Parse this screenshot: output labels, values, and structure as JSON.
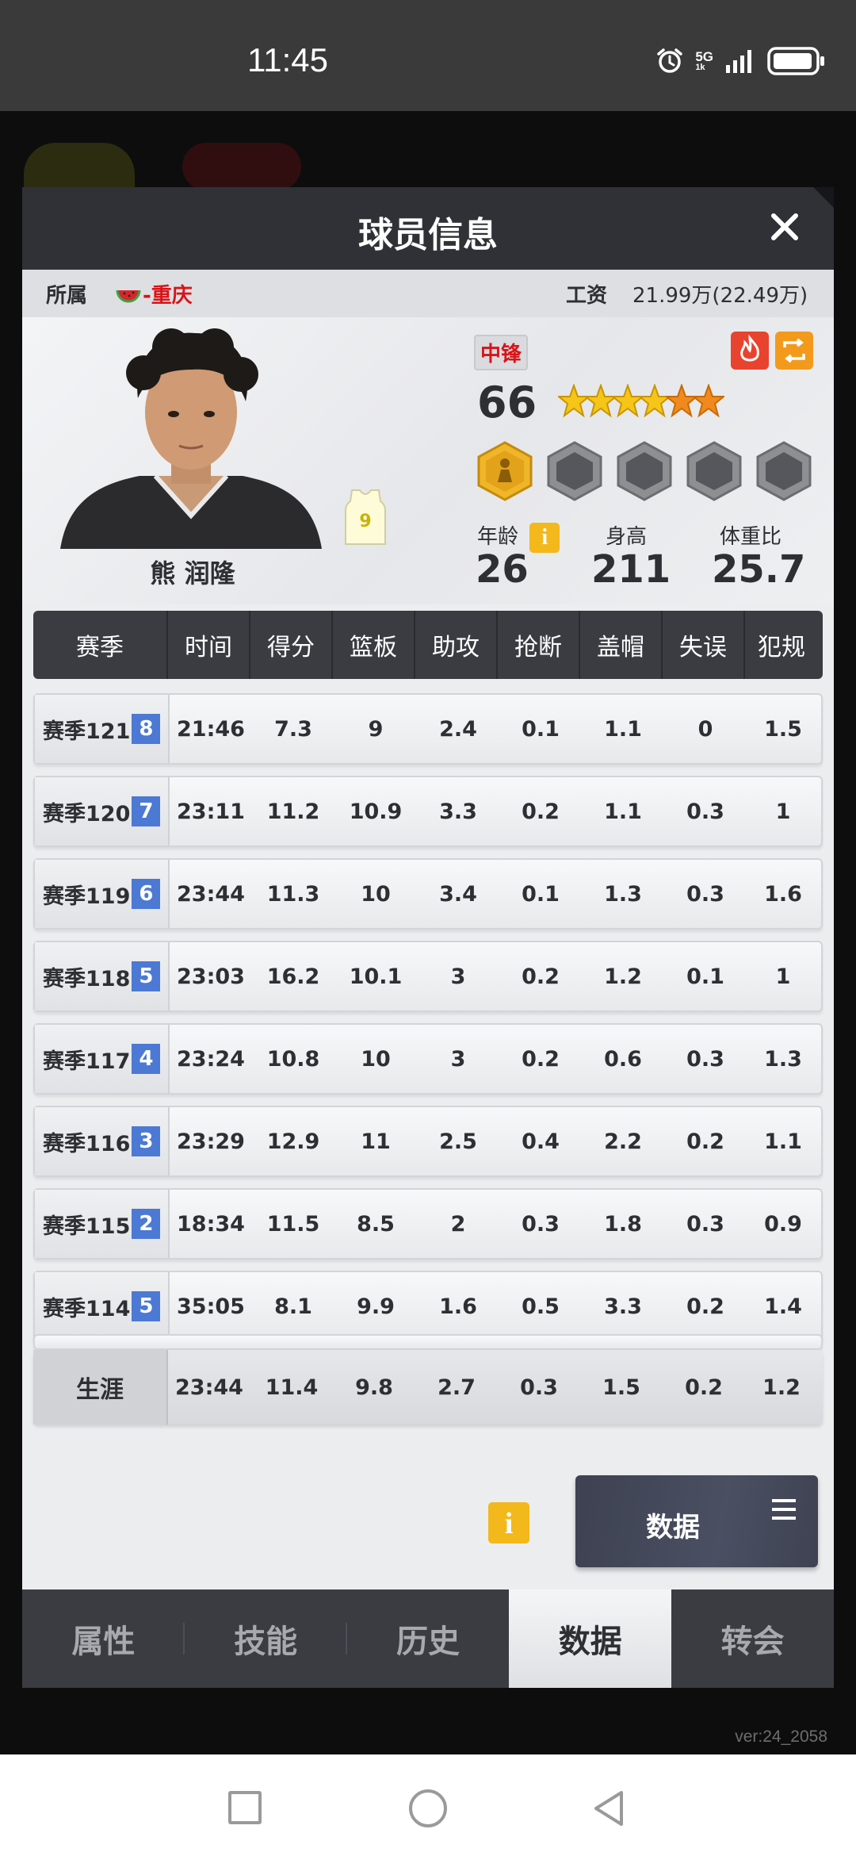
{
  "status_bar": {
    "time": "11:45",
    "network": "5G",
    "network_sub": "1k"
  },
  "modal": {
    "title": "球员信息"
  },
  "team_row": {
    "label": "所属",
    "team": "-重庆",
    "salary_label": "工资",
    "salary": "21.99万(22.49万)"
  },
  "player": {
    "name": "熊 润隆",
    "position": "中锋",
    "overall": "66",
    "jersey_number": "9",
    "stars_filled": 4,
    "stars_total": 6,
    "age_label": "年龄",
    "age": "26",
    "height_label": "身高",
    "height": "211",
    "weight_ratio_label": "体重比",
    "weight_ratio": "25.7",
    "info_glyph": "i"
  },
  "stats": {
    "headers": [
      "赛季",
      "时间",
      "得分",
      "篮板",
      "助攻",
      "抢断",
      "盖帽",
      "失误",
      "犯规"
    ],
    "rows": [
      {
        "season": "赛季121",
        "rank": "8",
        "time": "21:46",
        "pts": "7.3",
        "reb": "9",
        "ast": "2.4",
        "stl": "0.1",
        "blk": "1.1",
        "tov": "0",
        "pf": "1.5"
      },
      {
        "season": "赛季120",
        "rank": "7",
        "time": "23:11",
        "pts": "11.2",
        "reb": "10.9",
        "ast": "3.3",
        "stl": "0.2",
        "blk": "1.1",
        "tov": "0.3",
        "pf": "1"
      },
      {
        "season": "赛季119",
        "rank": "6",
        "time": "23:44",
        "pts": "11.3",
        "reb": "10",
        "ast": "3.4",
        "stl": "0.1",
        "blk": "1.3",
        "tov": "0.3",
        "pf": "1.6"
      },
      {
        "season": "赛季118",
        "rank": "5",
        "time": "23:03",
        "pts": "16.2",
        "reb": "10.1",
        "ast": "3",
        "stl": "0.2",
        "blk": "1.2",
        "tov": "0.1",
        "pf": "1"
      },
      {
        "season": "赛季117",
        "rank": "4",
        "time": "23:24",
        "pts": "10.8",
        "reb": "10",
        "ast": "3",
        "stl": "0.2",
        "blk": "0.6",
        "tov": "0.3",
        "pf": "1.3"
      },
      {
        "season": "赛季116",
        "rank": "3",
        "time": "23:29",
        "pts": "12.9",
        "reb": "11",
        "ast": "2.5",
        "stl": "0.4",
        "blk": "2.2",
        "tov": "0.2",
        "pf": "1.1"
      },
      {
        "season": "赛季115",
        "rank": "2",
        "time": "18:34",
        "pts": "11.5",
        "reb": "8.5",
        "ast": "2",
        "stl": "0.3",
        "blk": "1.8",
        "tov": "0.3",
        "pf": "0.9"
      },
      {
        "season": "赛季114",
        "rank": "5",
        "time": "35:05",
        "pts": "8.1",
        "reb": "9.9",
        "ast": "1.6",
        "stl": "0.5",
        "blk": "3.3",
        "tov": "0.2",
        "pf": "1.4"
      }
    ],
    "career": {
      "label": "生涯",
      "time": "23:44",
      "pts": "11.4",
      "reb": "9.8",
      "ast": "2.7",
      "stl": "0.3",
      "blk": "1.5",
      "tov": "0.2",
      "pf": "1.2"
    }
  },
  "actions": {
    "info_glyph": "i",
    "data_button": "数据"
  },
  "tabs": [
    "属性",
    "技能",
    "历史",
    "数据",
    "转会"
  ],
  "active_tab": "数据",
  "version": "ver:24_2058",
  "colors": {
    "team_red": "#d71418",
    "rank_blue": "#4b79d4",
    "info_yellow": "#f3b81b",
    "header_dark": "#3a3c42",
    "star_gold": "#f5c518",
    "star_orange": "#f08a1e"
  }
}
